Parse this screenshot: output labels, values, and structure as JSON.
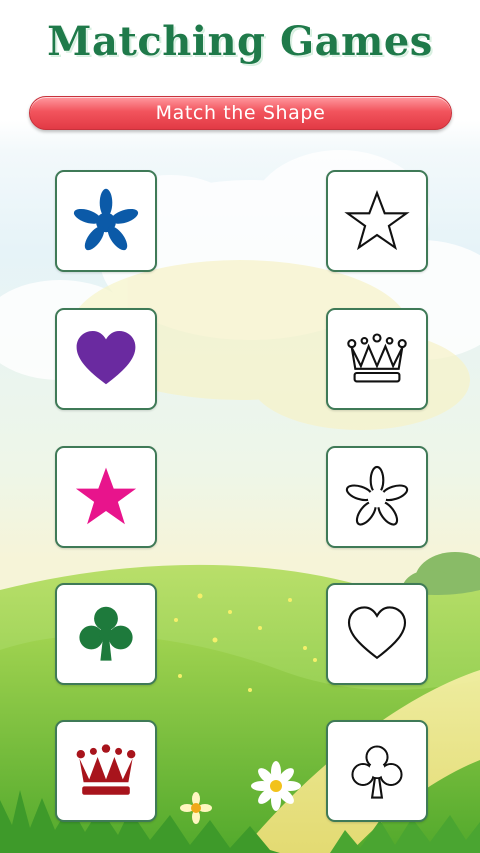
{
  "app": {
    "title": "Matching Games",
    "subtitle": "Match the Shape"
  },
  "colors": {
    "title_green": "#1f7a4a",
    "banner_red": "#e23a45",
    "flower_blue": "#0b5aa8",
    "heart_purple": "#6a2aa0",
    "star_magenta": "#e8148c",
    "club_green": "#1e7a3c",
    "crown_red": "#a8141c"
  },
  "left_column": [
    {
      "shape": "flower-icon",
      "style": "filled",
      "color": "#0b5aa8"
    },
    {
      "shape": "heart-icon",
      "style": "filled",
      "color": "#6a2aa0"
    },
    {
      "shape": "star-icon",
      "style": "filled",
      "color": "#e8148c"
    },
    {
      "shape": "club-icon",
      "style": "filled",
      "color": "#1e7a3c"
    },
    {
      "shape": "crown-icon",
      "style": "filled",
      "color": "#a8141c"
    }
  ],
  "right_column": [
    {
      "shape": "star-outline-icon",
      "style": "outline"
    },
    {
      "shape": "crown-outline-icon",
      "style": "outline"
    },
    {
      "shape": "flower-outline-icon",
      "style": "outline"
    },
    {
      "shape": "heart-outline-icon",
      "style": "outline"
    },
    {
      "shape": "club-outline-icon",
      "style": "outline"
    }
  ]
}
